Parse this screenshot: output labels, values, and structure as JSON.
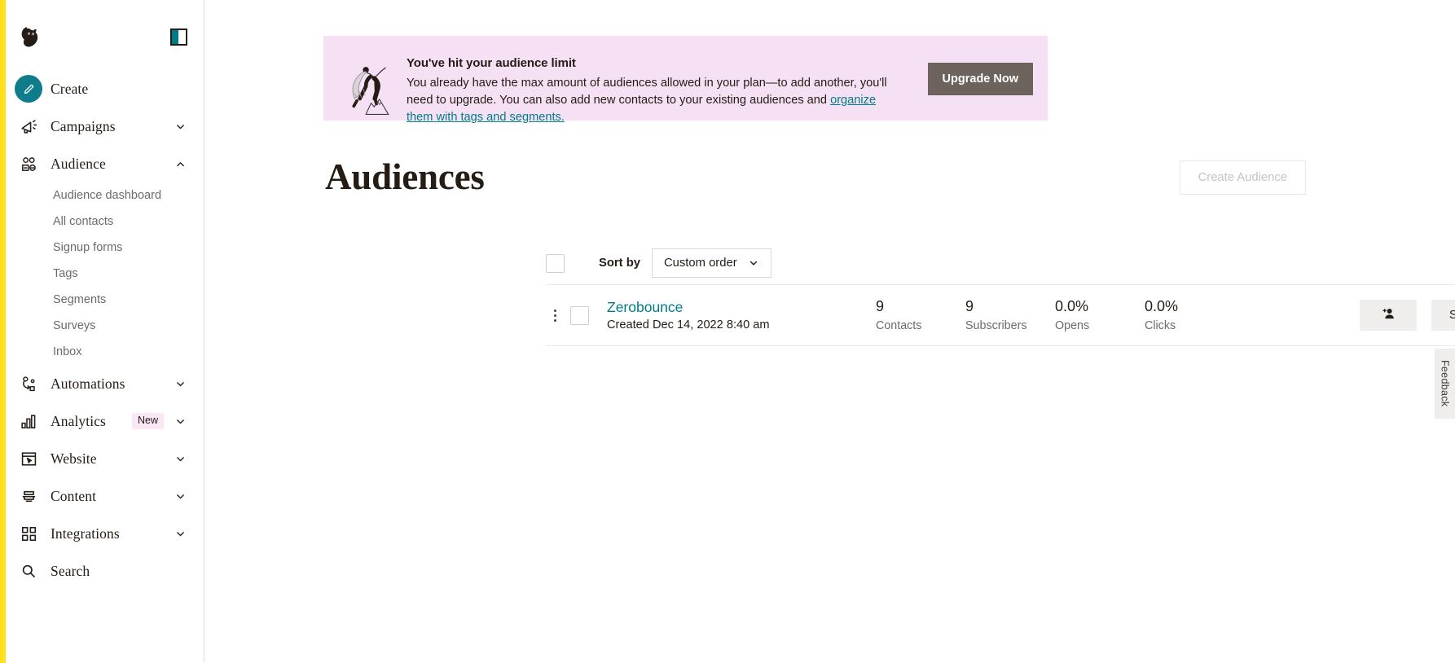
{
  "sidebar": {
    "logo_icon": "mailchimp-freddie-logo",
    "panel_toggle_icon": "panel-toggle-icon",
    "items": [
      {
        "label": "Create",
        "icon": "pencil-icon",
        "type": "primary",
        "expandable": false
      },
      {
        "label": "Campaigns",
        "icon": "megaphone-icon",
        "type": "nav",
        "expandable": true,
        "expanded": false
      },
      {
        "label": "Audience",
        "icon": "audience-icon",
        "type": "nav",
        "expandable": true,
        "expanded": true
      },
      {
        "label": "Automations",
        "icon": "automations-icon",
        "type": "nav",
        "expandable": true,
        "expanded": false
      },
      {
        "label": "Analytics",
        "icon": "bar-chart-icon",
        "type": "nav",
        "expandable": true,
        "expanded": false,
        "badge": "New"
      },
      {
        "label": "Website",
        "icon": "website-icon",
        "type": "nav",
        "expandable": true,
        "expanded": false
      },
      {
        "label": "Content",
        "icon": "content-icon",
        "type": "nav",
        "expandable": true,
        "expanded": false
      },
      {
        "label": "Integrations",
        "icon": "grid-icon",
        "type": "nav",
        "expandable": true,
        "expanded": false
      },
      {
        "label": "Search",
        "icon": "search-icon",
        "type": "nav",
        "expandable": false
      }
    ],
    "audience_subitems": [
      {
        "label": "Audience dashboard"
      },
      {
        "label": "All contacts"
      },
      {
        "label": "Signup forms"
      },
      {
        "label": "Tags"
      },
      {
        "label": "Segments"
      },
      {
        "label": "Surveys"
      },
      {
        "label": "Inbox"
      }
    ],
    "accent_color": "#ffe01b"
  },
  "banner": {
    "title": "You've hit your audience limit",
    "body_part1": "You already have the max amount of audiences allowed in your plan—to add another, you'll need to upgrade. You can also add new contacts to your existing audiences and ",
    "link_text": "organize them with tags and segments.",
    "button_label": "Upgrade Now",
    "background_color": "#f6e0f3",
    "button_color": "#6b635c",
    "illustration": "person-leaping-over-mountain-illustration"
  },
  "page": {
    "title": "Audiences",
    "create_button_label": "Create Audience",
    "create_button_disabled": true
  },
  "toolbar": {
    "select_all_checkbox": "unchecked",
    "sort_label": "Sort by",
    "sort_value": "Custom order",
    "sort_options": [
      "Custom order"
    ]
  },
  "audiences": [
    {
      "name": "Zerobounce",
      "created": "Created Dec 14, 2022 8:40 am",
      "checkbox": "unchecked",
      "stats": [
        {
          "value": "9",
          "label": "Contacts"
        },
        {
          "value": "9",
          "label": "Subscribers"
        },
        {
          "value": "0.0%",
          "label": "Opens"
        },
        {
          "value": "0.0%",
          "label": "Clicks"
        }
      ],
      "add_contact_icon": "add-person-icon",
      "stats_button_label": "Stats",
      "stats_caret_icon": "chevron-down-icon",
      "kebab_icon": "kebab-menu-icon"
    }
  ],
  "feedback": {
    "label": "Feedback"
  },
  "colors": {
    "brand_teal": "#007c89",
    "brand_yellow": "#ffe01b",
    "text_dark": "#241c15",
    "banner_pink": "#f6e0f3",
    "badge_pink": "#f9e7f6"
  }
}
